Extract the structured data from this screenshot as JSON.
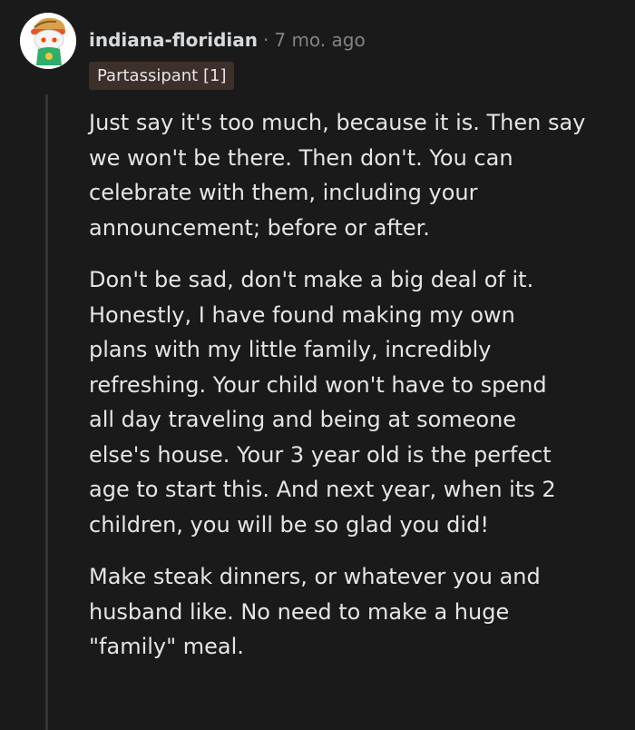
{
  "comment": {
    "username": "indiana-floridian",
    "separator": "·",
    "time_ago": "7 mo. ago",
    "flair": "Partassipant [1]",
    "avatar_icon": "snoo-avatar-icon",
    "paragraphs": [
      [
        "Just say it's too much, because it is. Then say",
        "we won't be there. Then don't. You can",
        "celebrate with them, including your",
        "announcement; before or after."
      ],
      [
        "Don't be sad, don't make a big deal of it.",
        "Honestly, I have found making my own",
        "plans with my little family, incredibly",
        "refreshing. Your child won't have to spend",
        "all day traveling and being at someone",
        "else's house. Your 3 year old is the perfect",
        "age to start this. And next year, when its 2",
        "children, you will be so glad you did!"
      ],
      [
        "Make steak dinners, or whatever you and",
        "husband like. No need to make a huge",
        "\"family\" meal."
      ]
    ]
  },
  "colors": {
    "background": "#1a1a1b",
    "text": "#d7dadc",
    "meta": "#818384",
    "flair_bg": "#3d2f2a",
    "thread_line": "#343536"
  }
}
